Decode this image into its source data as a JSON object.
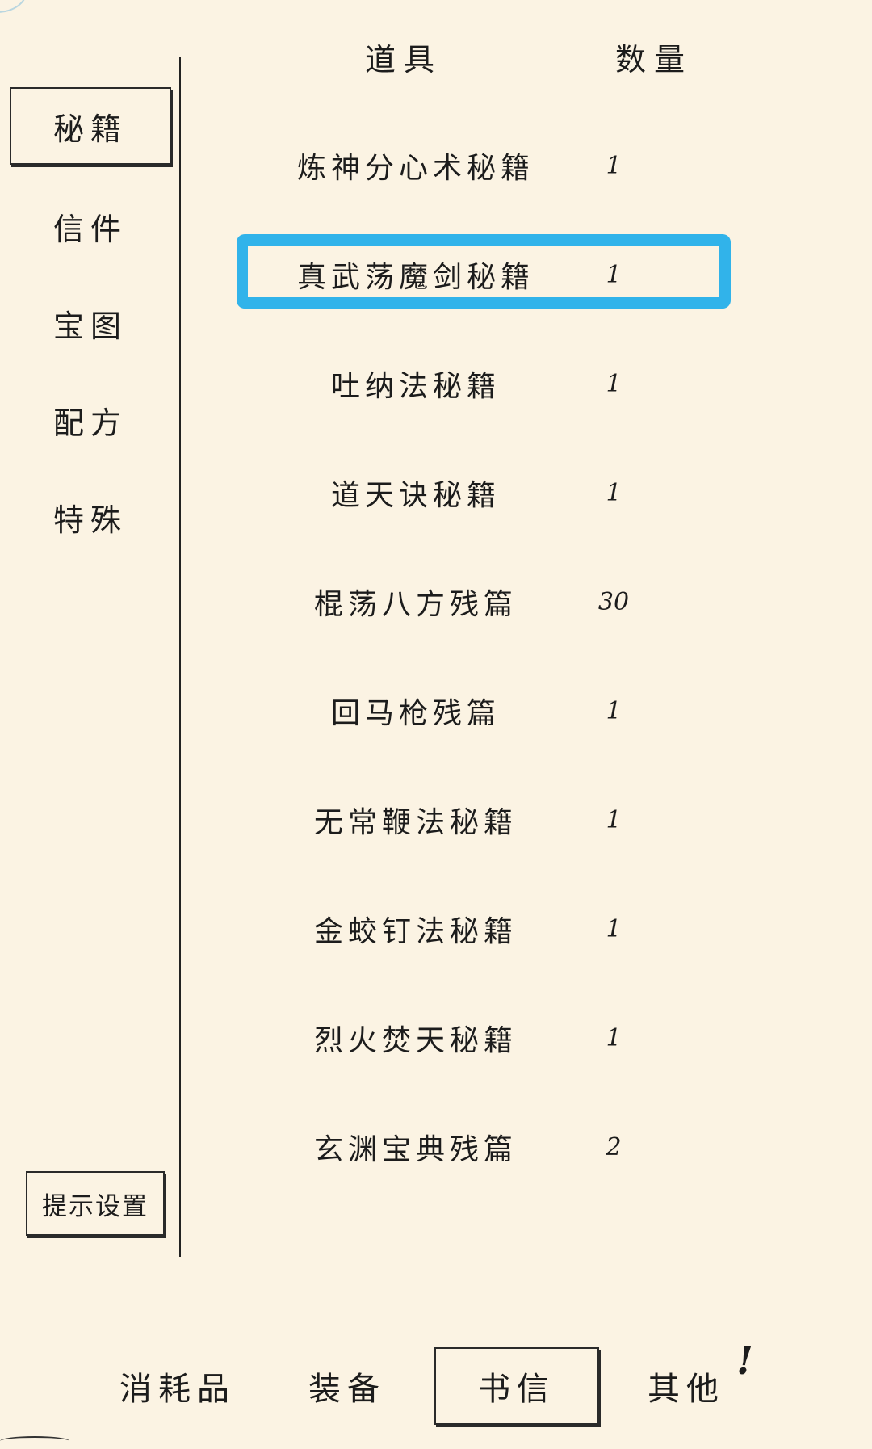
{
  "sidebar": {
    "items": [
      {
        "label": "秘籍",
        "active": true
      },
      {
        "label": "信件",
        "active": false
      },
      {
        "label": "宝图",
        "active": false
      },
      {
        "label": "配方",
        "active": false
      },
      {
        "label": "特殊",
        "active": false
      }
    ],
    "hint_settings_label": "提示设置"
  },
  "table": {
    "headers": {
      "item": "道具",
      "quantity": "数量"
    },
    "rows": [
      {
        "name": "炼神分心术秘籍",
        "qty": "1"
      },
      {
        "name": "真武荡魔剑秘籍",
        "qty": "1",
        "highlighted": true
      },
      {
        "name": "吐纳法秘籍",
        "qty": "1"
      },
      {
        "name": "道天诀秘籍",
        "qty": "1"
      },
      {
        "name": "棍荡八方残篇",
        "qty": "30"
      },
      {
        "name": "回马枪残篇",
        "qty": "1"
      },
      {
        "name": "无常鞭法秘籍",
        "qty": "1"
      },
      {
        "name": "金蛟钉法秘籍",
        "qty": "1"
      },
      {
        "name": "烈火焚天秘籍",
        "qty": "1"
      },
      {
        "name": "玄渊宝典残篇",
        "qty": "2"
      }
    ]
  },
  "bottom_tabs": {
    "items": [
      {
        "label": "消耗品",
        "active": false
      },
      {
        "label": "装备",
        "active": false
      },
      {
        "label": "书信",
        "active": true
      },
      {
        "label": "其他",
        "active": false
      }
    ],
    "alert_mark": "!"
  },
  "colors": {
    "background": "#fbf3e3",
    "highlight": "#31b3ea",
    "ink": "#1c1c1c"
  }
}
